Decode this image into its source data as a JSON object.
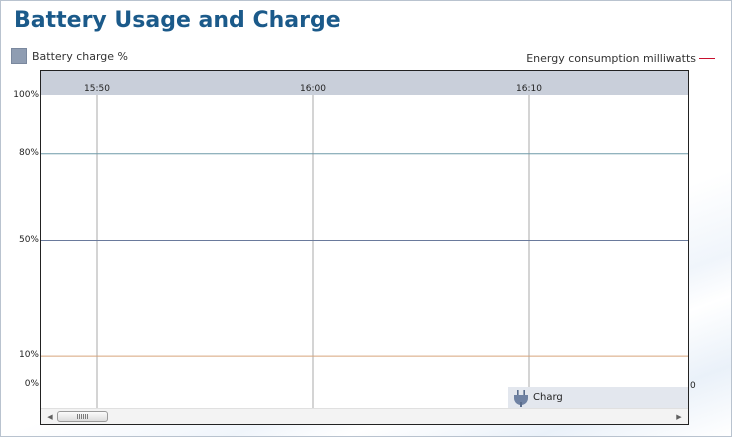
{
  "window": {
    "title": "Battery Usage and Charge"
  },
  "legend": {
    "left_label": "Battery charge %",
    "right_label": "Energy consumption milliwatts",
    "left_color": "#8f9db2",
    "right_color": "#c8102e"
  },
  "chart_data": {
    "type": "area",
    "x_ticks": [
      "15:50",
      "16:00",
      "16:10"
    ],
    "y_ticks": [
      "100%",
      "80%",
      "50%",
      "10%",
      "0%"
    ],
    "y_tick_values": [
      100,
      80,
      50,
      10,
      0
    ],
    "ylim": [
      0,
      100
    ],
    "secondary_axis_tick": "0",
    "threshold_lines": [
      {
        "value": 80,
        "color": "#6f9aa8"
      },
      {
        "value": 50,
        "color": "#6a7a9c"
      },
      {
        "value": 10,
        "color": "#d6a57b"
      }
    ],
    "series": []
  },
  "popup": {
    "label": "Charge",
    "icon": "plug-icon"
  }
}
